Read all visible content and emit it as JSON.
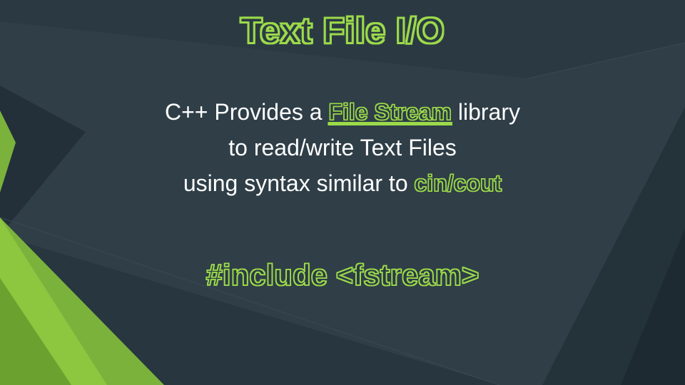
{
  "title": "Text File I/O",
  "body": {
    "line1_pre": "C++ Provides a ",
    "line1_emph": "File Stream",
    "line1_post": " library",
    "line2": " to read/write Text Files",
    "line3_pre": " using  syntax similar to ",
    "line3_emph": "cin/cout"
  },
  "include": "#include <fstream>"
}
